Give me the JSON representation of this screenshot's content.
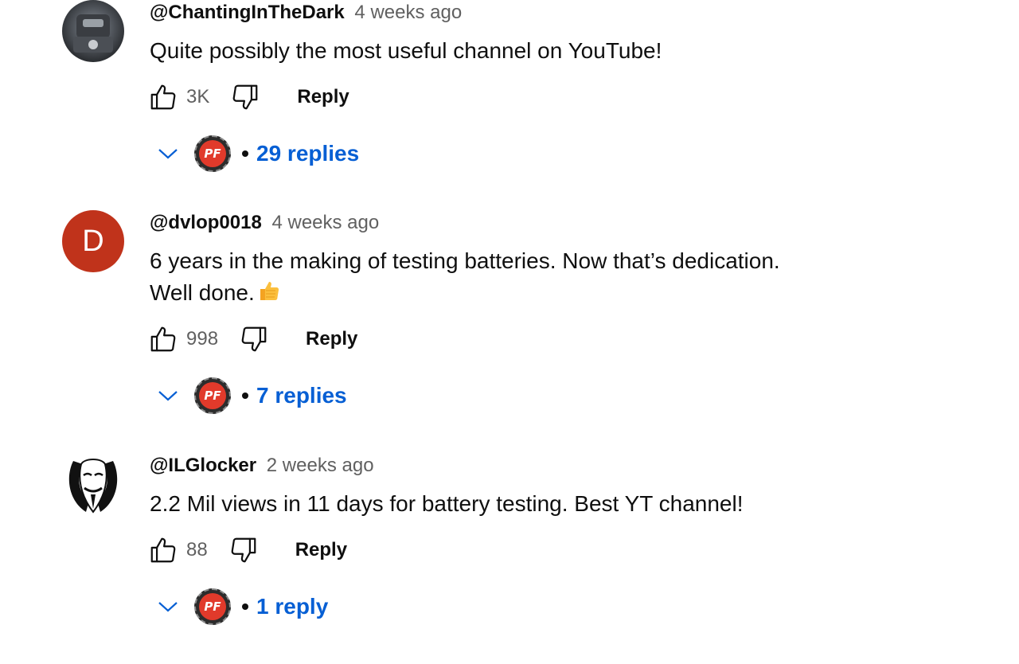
{
  "comments": [
    {
      "avatar": "photo-avatar",
      "author": "@ChantingInTheDark",
      "time": "4 weeks ago",
      "text_lines": [
        "Quite possibly the most useful channel on YouTube!"
      ],
      "likes": "3K",
      "reply_label": "Reply",
      "replies_label": "29 replies",
      "creator_badge": "PF"
    },
    {
      "avatar_letter": "D",
      "author": "@dvlop0018",
      "time": "4 weeks ago",
      "text_lines": [
        "6 years in the making of testing batteries. Now that’s dedication.",
        "Well done."
      ],
      "emoji": "thumbs-up-emoji",
      "likes": "998",
      "reply_label": "Reply",
      "replies_label": "7 replies",
      "creator_badge": "PF"
    },
    {
      "avatar": "mask-avatar",
      "author": "@ILGlocker",
      "time": "2 weeks ago",
      "text_lines": [
        "2.2 Mil views in 11 days for battery testing. Best YT channel!"
      ],
      "likes": "88",
      "reply_label": "Reply",
      "replies_label": "1 reply",
      "creator_badge": "PF"
    }
  ],
  "colors": {
    "link_blue": "#065fd4",
    "secondary_text": "#606060",
    "avatar_red": "#c0331b"
  }
}
